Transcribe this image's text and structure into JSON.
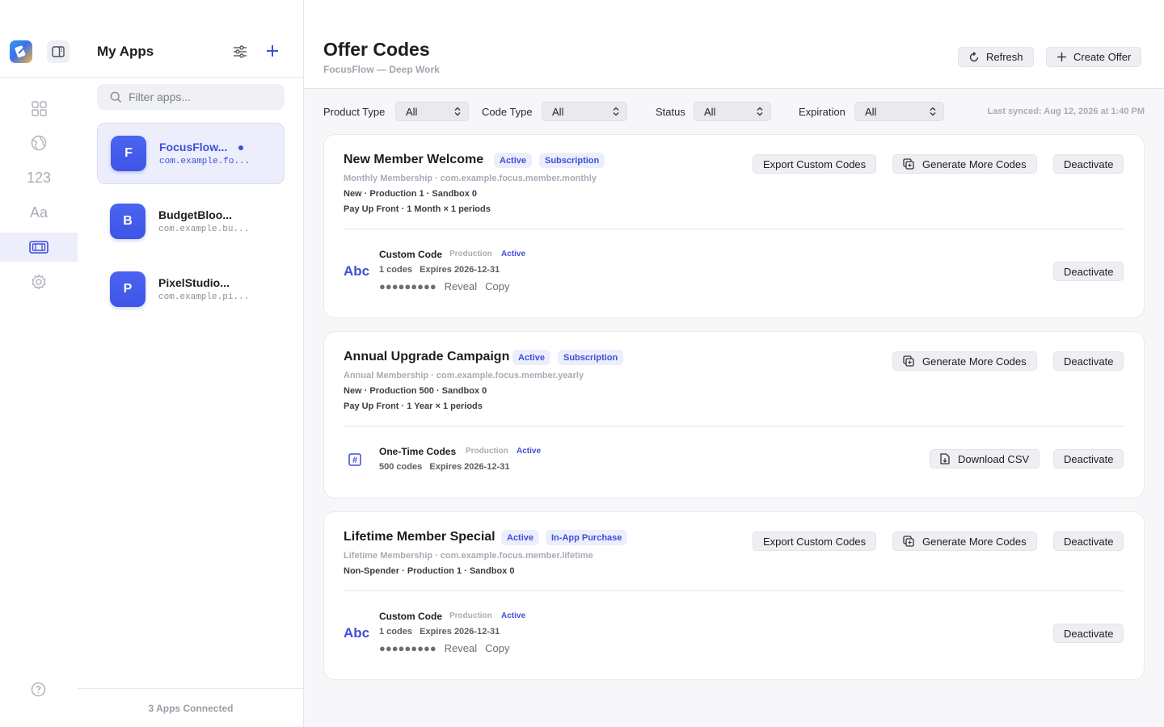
{
  "rail": {
    "items": [
      {
        "name": "grid-icon",
        "text": ""
      },
      {
        "name": "globe-icon",
        "text": ""
      },
      {
        "name": "numbers-nav",
        "text": "123"
      },
      {
        "name": "typography-nav",
        "text": "Aa"
      },
      {
        "name": "ticket-icon",
        "text": ""
      },
      {
        "name": "gear-icon",
        "text": ""
      }
    ]
  },
  "apps_panel": {
    "title": "My Apps",
    "filter_placeholder": "Filter apps...",
    "apps": [
      {
        "initial": "F",
        "name": "FocusFlow...",
        "bundle": "com.example.fo..."
      },
      {
        "initial": "B",
        "name": "BudgetBloo...",
        "bundle": "com.example.bu..."
      },
      {
        "initial": "P",
        "name": "PixelStudio...",
        "bundle": "com.example.pi..."
      }
    ],
    "footer": "3 Apps Connected"
  },
  "header": {
    "title": "Offer Codes",
    "subtitle": "FocusFlow — Deep Work",
    "refresh_label": "Refresh",
    "create_label": "Create Offer"
  },
  "filters": {
    "product_type": {
      "label": "Product Type",
      "value": "All"
    },
    "code_type": {
      "label": "Code Type",
      "value": "All"
    },
    "status": {
      "label": "Status",
      "value": "All"
    },
    "expiration": {
      "label": "Expiration",
      "value": "All"
    },
    "last_synced": "Last synced: Aug 12, 2026 at 1:40 PM"
  },
  "offers": [
    {
      "name": "New Member Welcome",
      "status": "Active",
      "type": "Subscription",
      "product": "Monthly Membership · com.example.focus.member.monthly",
      "eligibility": "New · Production 1 · Sandbox 0",
      "terms": "Pay Up Front · 1 Month × 1 periods",
      "export_label": "Export Custom Codes",
      "generate_label": "Generate More Codes",
      "deactivate_label": "Deactivate",
      "code": {
        "icon": "Abc",
        "title": "Custom Code",
        "env": "Production",
        "status": "Active",
        "count": "1 codes",
        "expires": "Expires 2026-12-31",
        "mask": "●●●●●●●●●",
        "reveal": "Reveal",
        "copy": "Copy",
        "deactivate_label": "Deactivate"
      }
    },
    {
      "name": "Annual Upgrade Campaign",
      "status": "Active",
      "type": "Subscription",
      "product": "Annual Membership · com.example.focus.member.yearly",
      "eligibility": "New · Production 500 · Sandbox 0",
      "terms": "Pay Up Front · 1 Year × 1 periods",
      "generate_label": "Generate More Codes",
      "deactivate_label": "Deactivate",
      "code": {
        "icon": "#",
        "title": "One-Time Codes",
        "env": "Production",
        "status": "Active",
        "count": "500 codes",
        "expires": "Expires 2026-12-31",
        "download_label": "Download CSV",
        "deactivate_label": "Deactivate"
      }
    },
    {
      "name": "Lifetime Member Special",
      "status": "Active",
      "type": "In-App Purchase",
      "product": "Lifetime Membership · com.example.focus.member.lifetime",
      "eligibility": "Non-Spender · Production 1 · Sandbox 0",
      "export_label": "Export Custom Codes",
      "generate_label": "Generate More Codes",
      "deactivate_label": "Deactivate",
      "code": {
        "icon": "Abc",
        "title": "Custom Code",
        "env": "Production",
        "status": "Active",
        "count": "1 codes",
        "expires": "Expires 2026-12-31",
        "mask": "●●●●●●●●●",
        "reveal": "Reveal",
        "copy": "Copy",
        "deactivate_label": "Deactivate"
      }
    }
  ],
  "colors": {
    "accent": "#3d4fd8",
    "badge_bg": "#eceefc",
    "page_bg": "#f7f7f9"
  }
}
